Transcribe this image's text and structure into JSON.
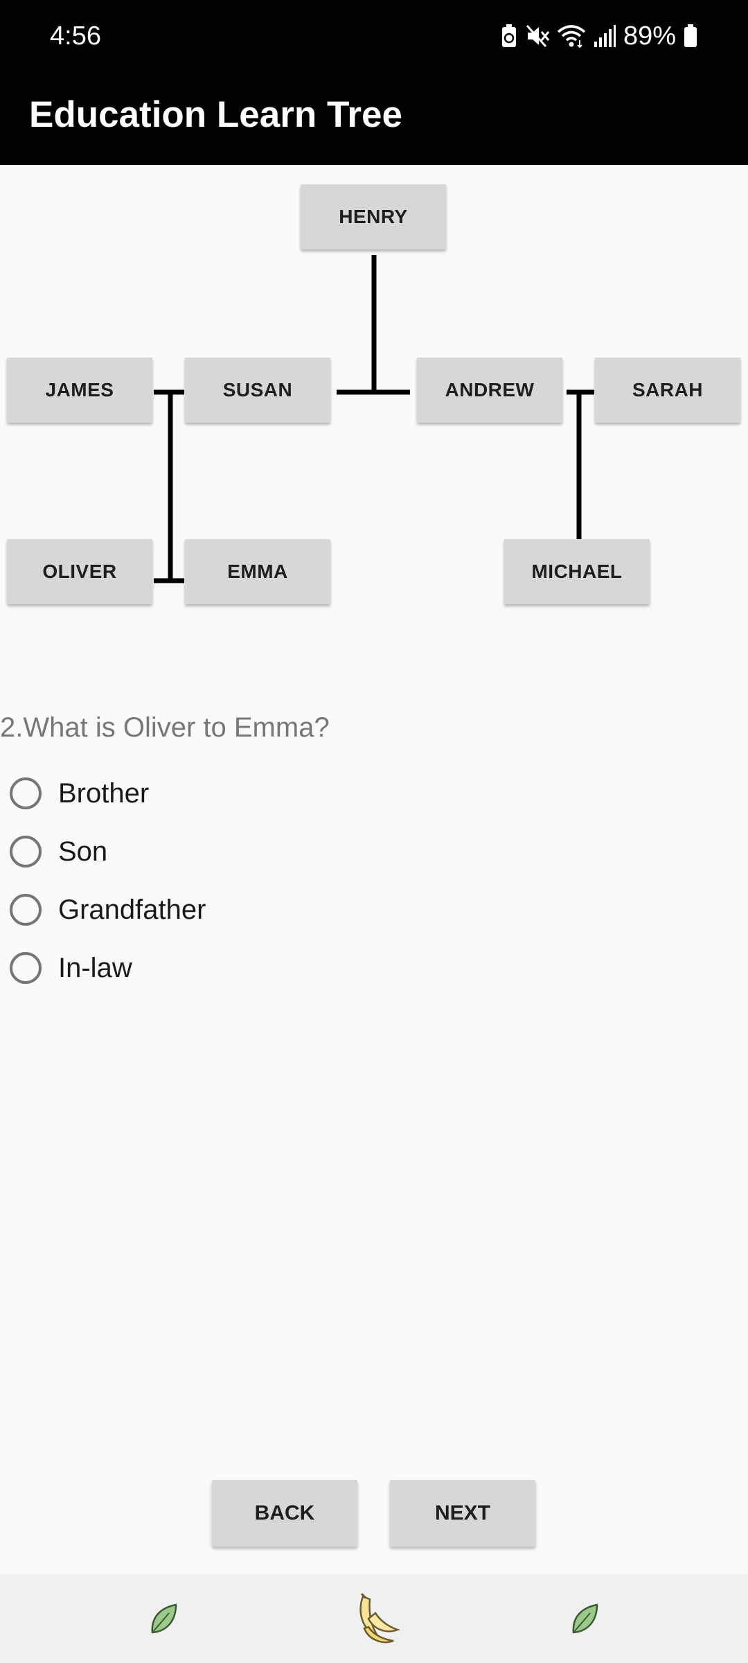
{
  "status_bar": {
    "time": "4:56",
    "battery_percent": "89%",
    "icons": [
      "battery-saver-icon",
      "mute-icon",
      "wifi-icon",
      "signal-icon",
      "battery-icon"
    ]
  },
  "app_bar": {
    "title": "Education Learn Tree"
  },
  "tree": {
    "nodes": {
      "henry": "HENRY",
      "james": "JAMES",
      "susan": "SUSAN",
      "andrew": "ANDREW",
      "sarah": "SARAH",
      "oliver": "OLIVER",
      "emma": "EMMA",
      "michael": "MICHAEL"
    }
  },
  "question": {
    "text": "2.What is Oliver to Emma?",
    "options": [
      "Brother",
      "Son",
      "Grandfather",
      "In-law"
    ]
  },
  "buttons": {
    "back": "BACK",
    "next": "NEXT"
  },
  "bottom_bar": {
    "icons": [
      "leaf-icon",
      "banana-icon",
      "leaf-icon"
    ]
  },
  "colors": {
    "app_bar_bg": "#000000",
    "node_bg": "#d6d7d7",
    "question_text": "#777777",
    "page_bg": "#fafafa"
  }
}
